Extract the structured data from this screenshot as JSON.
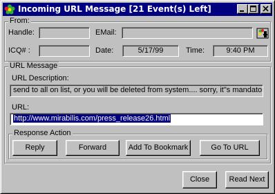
{
  "window": {
    "title": "Incoming URL Message [21 Event(s) Left]"
  },
  "colors": {
    "titlebar": "#000080",
    "face": "#c0c0c0",
    "selection": "#000080"
  },
  "from": {
    "group_label": "From:",
    "handle_label": "Handle:",
    "handle_value": "",
    "email_label": "EMail:",
    "email_value": "",
    "icq_label": "ICQ# :",
    "icq_value": "",
    "date_label": "Date:",
    "date_value": "5/17/99",
    "time_label": "Time:",
    "time_value": "9:40 PM",
    "icons": {
      "contact": "user-info-icon"
    }
  },
  "message": {
    "group_label": "URL Message",
    "desc_label": "URL Description:",
    "desc_value": "send to all on list, or you will be deleted from system.... sorry, it\"s mandatory",
    "url_label": "URL:",
    "url_value": "http://www.mirabilis.com/press_release26.html"
  },
  "response": {
    "group_label": "Response Action",
    "reply": "Reply",
    "forward": "Forward",
    "bookmark": "Add To Bookmark",
    "goto": "Go To URL"
  },
  "footer": {
    "close": "Close",
    "read_next": "Read Next"
  }
}
